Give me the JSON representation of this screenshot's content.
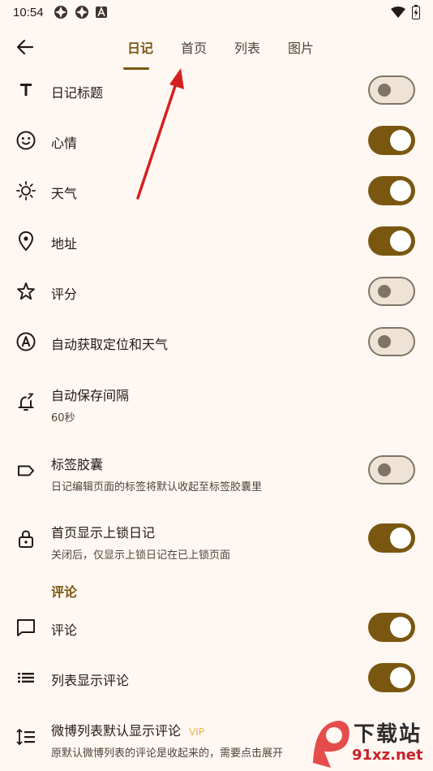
{
  "status_bar": {
    "time": "10:54"
  },
  "tabs": [
    {
      "label": "日记",
      "active": true
    },
    {
      "label": "首页",
      "active": false
    },
    {
      "label": "列表",
      "active": false
    },
    {
      "label": "图片",
      "active": false
    }
  ],
  "settings": [
    {
      "title": "日记标题",
      "subtitle": "",
      "icon": "title-text-icon",
      "on": false
    },
    {
      "title": "心情",
      "subtitle": "",
      "icon": "smiley-icon",
      "on": true
    },
    {
      "title": "天气",
      "subtitle": "",
      "icon": "sun-icon",
      "on": true
    },
    {
      "title": "地址",
      "subtitle": "",
      "icon": "location-pin-icon",
      "on": true
    },
    {
      "title": "评分",
      "subtitle": "",
      "icon": "star-icon",
      "on": false
    },
    {
      "title": "自动获取定位和天气",
      "subtitle": "",
      "icon": "auto-a-icon",
      "on": false
    },
    {
      "title": "自动保存间隔",
      "subtitle": "60秒",
      "icon": "alarm-bell-icon"
    },
    {
      "title": "标签胶囊",
      "subtitle": "日记编辑页面的标签将默认收起至标签胶囊里",
      "icon": "label-tag-icon",
      "on": false
    },
    {
      "title": "首页显示上锁日记",
      "subtitle": "关闭后，仅显示上锁日记在已上锁页面",
      "icon": "lock-icon",
      "on": true
    }
  ],
  "comments_section": {
    "header": "评论",
    "items": [
      {
        "title": "评论",
        "subtitle": "",
        "icon": "comment-icon",
        "on": true
      },
      {
        "title": "列表显示评论",
        "subtitle": "",
        "icon": "list-icon",
        "on": true
      },
      {
        "title": "微博列表默认显示评论",
        "badge": "VIP",
        "subtitle": "原默认微博列表的评论是收起来的，需要点击展开",
        "icon": "line-spacing-icon"
      }
    ]
  },
  "watermark": {
    "line1": "下载站",
    "line2": "91xz.net"
  },
  "colors": {
    "background": "#fff7f2",
    "accent": "#7a5710",
    "annotation_arrow": "#d42020"
  }
}
